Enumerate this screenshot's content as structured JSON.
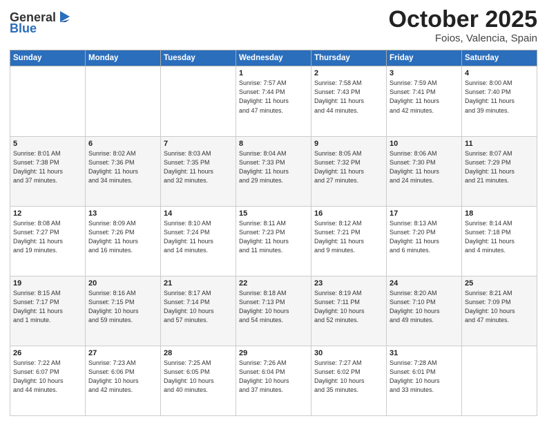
{
  "header": {
    "logo_general": "General",
    "logo_blue": "Blue",
    "month": "October 2025",
    "location": "Foios, Valencia, Spain"
  },
  "weekdays": [
    "Sunday",
    "Monday",
    "Tuesday",
    "Wednesday",
    "Thursday",
    "Friday",
    "Saturday"
  ],
  "weeks": [
    [
      {
        "day": "",
        "info": ""
      },
      {
        "day": "",
        "info": ""
      },
      {
        "day": "",
        "info": ""
      },
      {
        "day": "1",
        "info": "Sunrise: 7:57 AM\nSunset: 7:44 PM\nDaylight: 11 hours\nand 47 minutes."
      },
      {
        "day": "2",
        "info": "Sunrise: 7:58 AM\nSunset: 7:43 PM\nDaylight: 11 hours\nand 44 minutes."
      },
      {
        "day": "3",
        "info": "Sunrise: 7:59 AM\nSunset: 7:41 PM\nDaylight: 11 hours\nand 42 minutes."
      },
      {
        "day": "4",
        "info": "Sunrise: 8:00 AM\nSunset: 7:40 PM\nDaylight: 11 hours\nand 39 minutes."
      }
    ],
    [
      {
        "day": "5",
        "info": "Sunrise: 8:01 AM\nSunset: 7:38 PM\nDaylight: 11 hours\nand 37 minutes."
      },
      {
        "day": "6",
        "info": "Sunrise: 8:02 AM\nSunset: 7:36 PM\nDaylight: 11 hours\nand 34 minutes."
      },
      {
        "day": "7",
        "info": "Sunrise: 8:03 AM\nSunset: 7:35 PM\nDaylight: 11 hours\nand 32 minutes."
      },
      {
        "day": "8",
        "info": "Sunrise: 8:04 AM\nSunset: 7:33 PM\nDaylight: 11 hours\nand 29 minutes."
      },
      {
        "day": "9",
        "info": "Sunrise: 8:05 AM\nSunset: 7:32 PM\nDaylight: 11 hours\nand 27 minutes."
      },
      {
        "day": "10",
        "info": "Sunrise: 8:06 AM\nSunset: 7:30 PM\nDaylight: 11 hours\nand 24 minutes."
      },
      {
        "day": "11",
        "info": "Sunrise: 8:07 AM\nSunset: 7:29 PM\nDaylight: 11 hours\nand 21 minutes."
      }
    ],
    [
      {
        "day": "12",
        "info": "Sunrise: 8:08 AM\nSunset: 7:27 PM\nDaylight: 11 hours\nand 19 minutes."
      },
      {
        "day": "13",
        "info": "Sunrise: 8:09 AM\nSunset: 7:26 PM\nDaylight: 11 hours\nand 16 minutes."
      },
      {
        "day": "14",
        "info": "Sunrise: 8:10 AM\nSunset: 7:24 PM\nDaylight: 11 hours\nand 14 minutes."
      },
      {
        "day": "15",
        "info": "Sunrise: 8:11 AM\nSunset: 7:23 PM\nDaylight: 11 hours\nand 11 minutes."
      },
      {
        "day": "16",
        "info": "Sunrise: 8:12 AM\nSunset: 7:21 PM\nDaylight: 11 hours\nand 9 minutes."
      },
      {
        "day": "17",
        "info": "Sunrise: 8:13 AM\nSunset: 7:20 PM\nDaylight: 11 hours\nand 6 minutes."
      },
      {
        "day": "18",
        "info": "Sunrise: 8:14 AM\nSunset: 7:18 PM\nDaylight: 11 hours\nand 4 minutes."
      }
    ],
    [
      {
        "day": "19",
        "info": "Sunrise: 8:15 AM\nSunset: 7:17 PM\nDaylight: 11 hours\nand 1 minute."
      },
      {
        "day": "20",
        "info": "Sunrise: 8:16 AM\nSunset: 7:15 PM\nDaylight: 10 hours\nand 59 minutes."
      },
      {
        "day": "21",
        "info": "Sunrise: 8:17 AM\nSunset: 7:14 PM\nDaylight: 10 hours\nand 57 minutes."
      },
      {
        "day": "22",
        "info": "Sunrise: 8:18 AM\nSunset: 7:13 PM\nDaylight: 10 hours\nand 54 minutes."
      },
      {
        "day": "23",
        "info": "Sunrise: 8:19 AM\nSunset: 7:11 PM\nDaylight: 10 hours\nand 52 minutes."
      },
      {
        "day": "24",
        "info": "Sunrise: 8:20 AM\nSunset: 7:10 PM\nDaylight: 10 hours\nand 49 minutes."
      },
      {
        "day": "25",
        "info": "Sunrise: 8:21 AM\nSunset: 7:09 PM\nDaylight: 10 hours\nand 47 minutes."
      }
    ],
    [
      {
        "day": "26",
        "info": "Sunrise: 7:22 AM\nSunset: 6:07 PM\nDaylight: 10 hours\nand 44 minutes."
      },
      {
        "day": "27",
        "info": "Sunrise: 7:23 AM\nSunset: 6:06 PM\nDaylight: 10 hours\nand 42 minutes."
      },
      {
        "day": "28",
        "info": "Sunrise: 7:25 AM\nSunset: 6:05 PM\nDaylight: 10 hours\nand 40 minutes."
      },
      {
        "day": "29",
        "info": "Sunrise: 7:26 AM\nSunset: 6:04 PM\nDaylight: 10 hours\nand 37 minutes."
      },
      {
        "day": "30",
        "info": "Sunrise: 7:27 AM\nSunset: 6:02 PM\nDaylight: 10 hours\nand 35 minutes."
      },
      {
        "day": "31",
        "info": "Sunrise: 7:28 AM\nSunset: 6:01 PM\nDaylight: 10 hours\nand 33 minutes."
      },
      {
        "day": "",
        "info": ""
      }
    ]
  ]
}
